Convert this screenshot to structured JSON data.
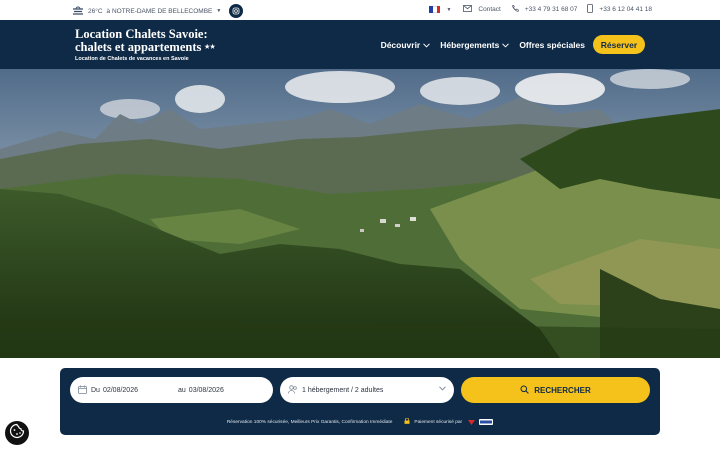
{
  "topbar": {
    "temperature": "26°C",
    "location": "à NOTRE-DAME DE BELLECOMBE",
    "contact_label": "Contact",
    "phone1": "+33 4 79 31 68 07",
    "phone2": "+33 6 12 04 41 18"
  },
  "header": {
    "title_line1": "Location Chalets Savoie:",
    "title_line2": "chalets et appartements",
    "title_stars": "★★",
    "subtitle": "Location de Chalets de vacances en Savoie",
    "nav": [
      {
        "label": "Découvrir"
      },
      {
        "label": "Hébergements"
      },
      {
        "label": "Offres spéciales"
      }
    ],
    "reserve_label": "Réserver"
  },
  "search": {
    "date_from_prefix": "Du",
    "date_from": "02/08/2026",
    "date_to_prefix": "au",
    "date_to": "03/08/2026",
    "guests": "1 hébergement / 2 adultes",
    "search_label": "RECHERCHER",
    "note": "Réservation 100% sécurisée, Meilleurs Prix Garantis, Confirmation Immédiate",
    "payment_label": "Paiement sécurisé par"
  },
  "colors": {
    "navy": "#0f2a46",
    "accent": "#f5c21b"
  },
  "icons": {
    "weather": "weather-icon",
    "instagram": "instagram-icon",
    "mail": "mail-icon",
    "phone": "phone-icon",
    "mobile": "mobile-icon",
    "calendar": "calendar-icon",
    "people": "people-icon",
    "search": "search-icon",
    "cookie": "cookie-icon",
    "lock": "lock-icon"
  }
}
